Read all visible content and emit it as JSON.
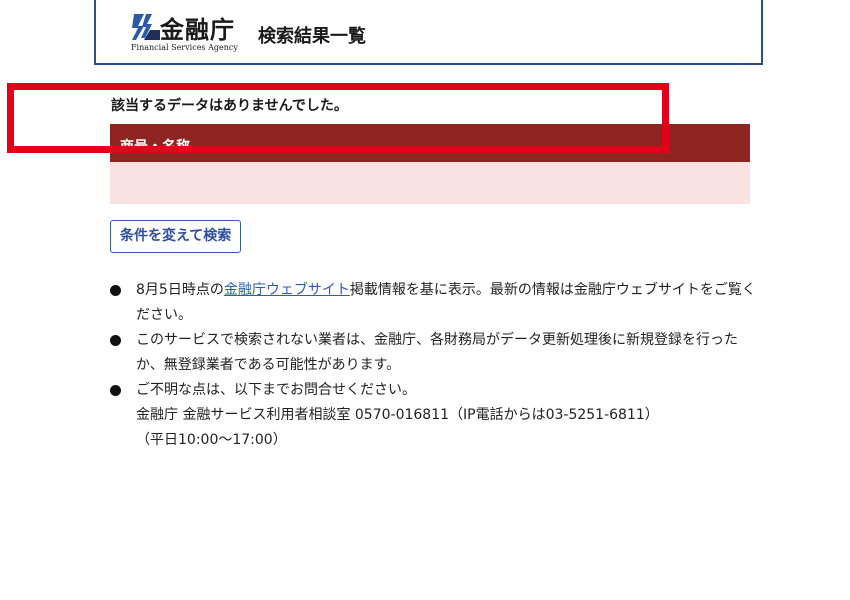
{
  "header": {
    "logo_kanji": "金融庁",
    "logo_english": "Financial Services Agency",
    "title": "検索結果一覧"
  },
  "result": {
    "message": "該当するデータはありませんでした。",
    "table_header": "商号・名称"
  },
  "actions": {
    "search_again": "条件を変えて検索"
  },
  "notes": {
    "note1_prefix": "8月5日時点の",
    "note1_link": "金融庁ウェブサイト",
    "note1_suffix": "掲載情報を基に表示。最新の情報は金融庁ウェブサイトをご覧ください。",
    "note2": "このサービスで検索されない業者は、金融庁、各財務局がデータ更新処理後に新規登録を行ったか、無登録業者である可能性があります。",
    "note3_line1": "ご不明な点は、以下までお問合せください。",
    "note3_line2": "金融庁 金融サービス利用者相談室 0570-016811（IP電話からは03-5251-6811）",
    "note3_line3": "（平日10:00〜17:00）"
  },
  "colors": {
    "header_border": "#2e4f8f",
    "table_header_bg": "#8f2520",
    "table_row_bg": "#f9e2e1",
    "highlight": "#e3001b",
    "link": "#2e5bb8"
  }
}
